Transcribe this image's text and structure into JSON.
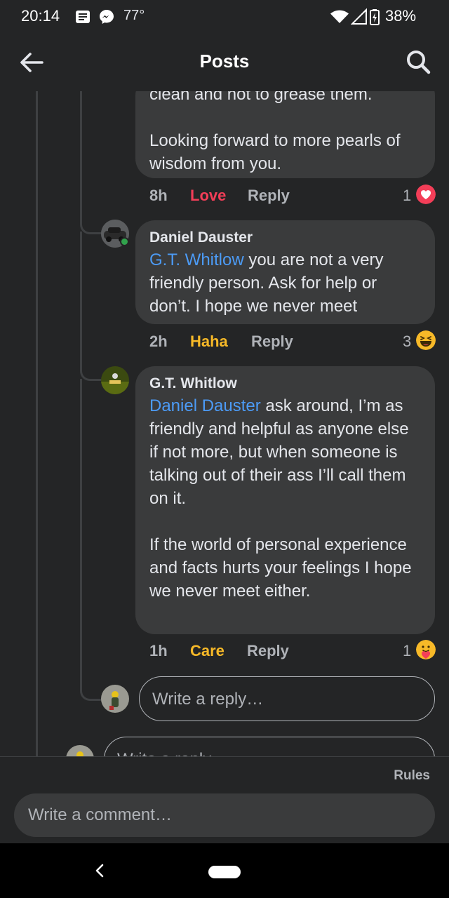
{
  "status_bar": {
    "time": "20:14",
    "temperature": "77°",
    "battery": "38%",
    "icons": [
      "news-icon",
      "messenger-icon",
      "wifi-icon",
      "signal-icon",
      "battery-icon"
    ]
  },
  "header": {
    "title": "Posts",
    "back_icon": "arrow-left-icon",
    "search_icon": "search-icon"
  },
  "thread": {
    "top_bubble": {
      "text_partial": "clean and not to grease them.",
      "text_para2": "Looking forward to more pearls of wisdom from you.",
      "time": "8h",
      "reaction_label": "Love",
      "reply_label": "Reply",
      "reaction_count": "1",
      "reaction_emoji": "heart-icon"
    },
    "comments": [
      {
        "author": "Daniel Dauster",
        "mention": "G.T. Whitlow",
        "text": " you are not a very friendly person. Ask for help or don’t. I hope we never meet",
        "time": "2h",
        "reaction_label": "Haha",
        "reply_label": "Reply",
        "reaction_count": "3",
        "reaction_emoji": "haha-icon"
      },
      {
        "author": "G.T. Whitlow",
        "mention": "Daniel Dauster",
        "text": " ask around, I’m as friendly and helpful as anyone else if not more, but when someone is talking out of their ass I’ll call them on it.",
        "text_para2": "If the world of personal experience and facts hurts your feelings I hope we never meet either.",
        "time": "1h",
        "reaction_label": "Care",
        "reply_label": "Reply",
        "reaction_count": "1",
        "reaction_emoji": "care-icon"
      }
    ],
    "reply_placeholder": "Write a reply…",
    "reply_placeholder_2": "Write a reply…"
  },
  "comment_bar": {
    "rules_label": "Rules",
    "placeholder": "Write a comment…"
  },
  "colors": {
    "background": "#242526",
    "bubble": "#3a3b3c",
    "mention": "#4c9bf6",
    "love": "#f33e58",
    "gold": "#f7b928"
  }
}
